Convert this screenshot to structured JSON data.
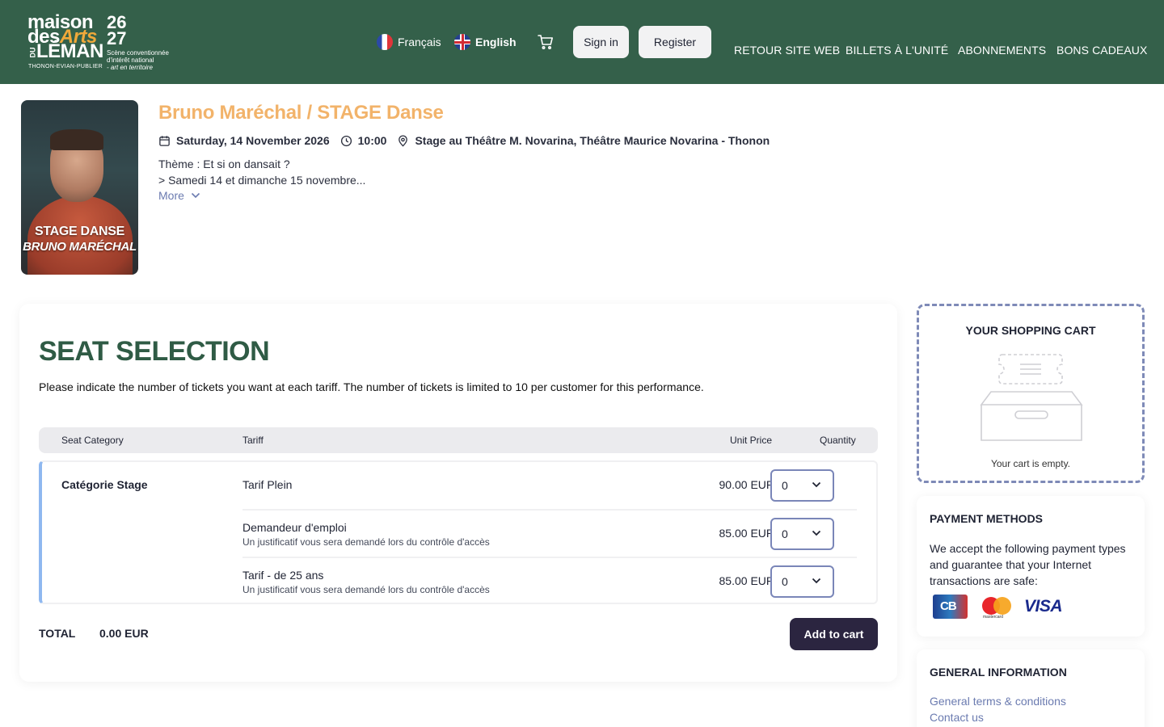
{
  "brand": {
    "line1": "maison",
    "line2_a": "des",
    "line2_b": "Arts",
    "line3_du": "DU",
    "line3": "LÉMAN",
    "years_top": "26",
    "years_bottom": "27",
    "tag1": "Scène conventionnée",
    "tag2": "d'intérêt national",
    "tag3": "- art en territoire",
    "city": "THONON-EVIAN-PUBLIER"
  },
  "header": {
    "lang_fr": "Français",
    "lang_en": "English",
    "signin": "Sign in",
    "register": "Register",
    "nav": [
      "RETOUR SITE WEB",
      "BILLETS À L'UNITÉ",
      "ABONNEMENTS",
      "BONS CADEAUX"
    ]
  },
  "event": {
    "poster_line1": "STAGE DANSE",
    "poster_line2": "BRUNO MARÉCHAL",
    "title": "Bruno Maréchal / STAGE Danse",
    "date": "Saturday, 14 November 2026",
    "time": "10:00",
    "venue": "Stage au Théâtre M. Novarina, Théâtre Maurice Novarina - Thonon",
    "desc1": "Thème :  Et si on dansait ?",
    "desc2": "> Samedi 14 et dimanche 15 novembre...",
    "more": "More"
  },
  "seats": {
    "heading": "SEAT SELECTION",
    "intro": "Please indicate the number of tickets you want at each tariff. The number of tickets is limited to 10 per customer for this performance.",
    "col_category": "Seat Category",
    "col_tariff": "Tariff",
    "col_price": "Unit Price",
    "col_qty": "Quantity",
    "category": "Catégorie Stage",
    "rows": [
      {
        "name": "Tarif Plein",
        "sub": "",
        "price": "90.00 EUR",
        "qty": "0"
      },
      {
        "name": "Demandeur d'emploi",
        "sub": "Un justificatif vous sera demandé lors du contrôle d'accès",
        "price": "85.00 EUR",
        "qty": "0"
      },
      {
        "name": "Tarif - de 25 ans",
        "sub": "Un justificatif vous sera demandé lors du contrôle d'accès",
        "price": "85.00 EUR",
        "qty": "0"
      }
    ],
    "total_label": "TOTAL",
    "total_value": "0.00 EUR",
    "add_to_cart": "Add to cart"
  },
  "cart": {
    "title": "YOUR SHOPPING CART",
    "empty": "Your cart is empty."
  },
  "payment": {
    "title": "PAYMENT METHODS",
    "text": "We accept the following payment types and guarantee that your Internet transactions are safe:",
    "mastercard_label": "mastercard",
    "visa_label": "VISA"
  },
  "info": {
    "title": "GENERAL INFORMATION",
    "links": [
      "General terms & conditions",
      "Contact us"
    ]
  },
  "colors": {
    "header_bg": "#34604a",
    "title_accent": "#f2b36a",
    "heading_green": "#2f5b45",
    "primary_button": "#2b2540"
  }
}
